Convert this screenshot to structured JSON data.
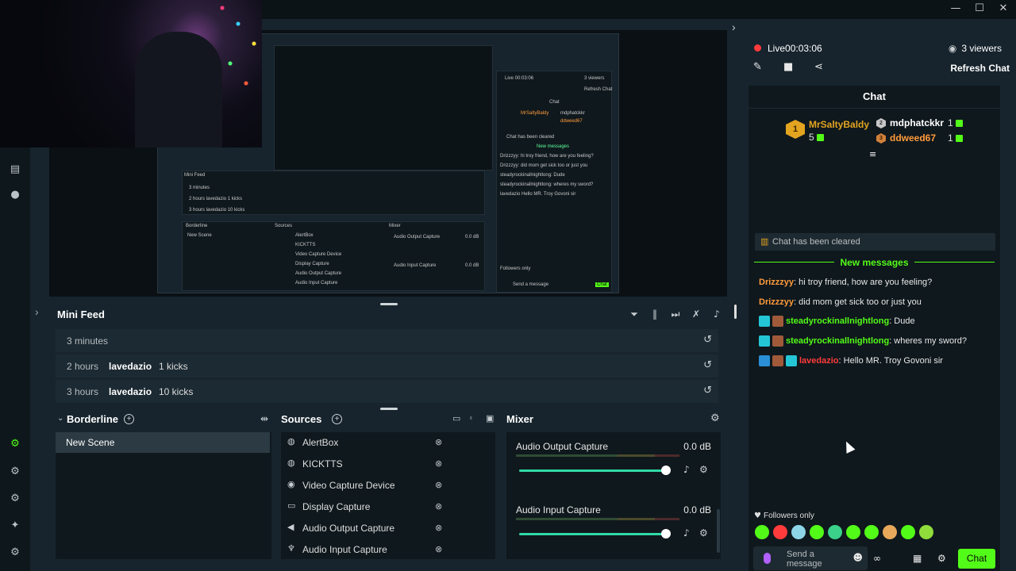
{
  "window": {
    "minimize": "—",
    "maximize": "☐",
    "close": "✕"
  },
  "mini_feed": {
    "title": "Mini Feed",
    "rows": [
      {
        "time": "3 minutes",
        "user": "",
        "detail": ""
      },
      {
        "time": "2 hours",
        "user": "lavedazio",
        "detail": "1 kicks"
      },
      {
        "time": "3 hours",
        "user": "lavedazio",
        "detail": "10 kicks"
      }
    ]
  },
  "scenes": {
    "title": "Borderline",
    "items": [
      "New Scene"
    ]
  },
  "sources": {
    "title": "Sources",
    "items": [
      {
        "name": "AlertBox",
        "icon": "globe-icon"
      },
      {
        "name": "KICKTTS",
        "icon": "globe-icon"
      },
      {
        "name": "Video Capture Device",
        "icon": "webcam-icon"
      },
      {
        "name": "Display Capture",
        "icon": "monitor-icon"
      },
      {
        "name": "Audio Output Capture",
        "icon": "speaker-icon"
      },
      {
        "name": "Audio Input Capture",
        "icon": "microphone-icon"
      }
    ]
  },
  "mixer": {
    "title": "Mixer",
    "items": [
      {
        "name": "Audio Output Capture",
        "level": "0.0 dB",
        "fader": 1.0
      },
      {
        "name": "Audio Input Capture",
        "level": "0.0 dB",
        "fader": 1.0
      }
    ]
  },
  "chat_panel": {
    "live_label": "Live",
    "live_time": "00:03:06",
    "viewers": "3 viewers",
    "refresh_label": "Refresh Chat",
    "chat_title": "Chat",
    "leaderboard": {
      "first": {
        "rank": "1",
        "name": "MrSaltyBaldy",
        "count": "5"
      },
      "second": {
        "name": "mdphatckkr",
        "count": "1"
      },
      "third": {
        "name": "ddweed67",
        "count": "1"
      }
    },
    "cleared_text": "Chat has been cleared",
    "new_messages_label": "New messages",
    "messages": [
      {
        "user": "Drizzzyy",
        "text": ": hi troy friend, how are you feeling?",
        "color": "#ff9b3b"
      },
      {
        "user": "Drizzzyy",
        "text": ": did mom get sick too or just you",
        "color": "#ff9b3b"
      },
      {
        "user": "steadyrockinallnightlong",
        "text": ": Dude",
        "color": "#53fc18"
      },
      {
        "user": "steadyrockinallnightlong",
        "text": ": wheres my sword?",
        "color": "#53fc18"
      },
      {
        "user": "lavedazio",
        "text": ": Hello MR. Troy Govoni sir",
        "color": "#ff3b3b"
      }
    ],
    "followers_only": "Followers only",
    "send_placeholder": "Send a message",
    "send_button": "Chat"
  },
  "preview_mini": {
    "live": "Live 00:03:06",
    "viewers": "3 viewers",
    "refresh": "Refresh Chat",
    "chat": "Chat",
    "top": "MrSaltyBaldy",
    "second": "mdphatckkr",
    "third": "ddweed67",
    "cleared": "Chat has been cleared",
    "new_messages": "New messages",
    "m1": "Drizzzyy: hi troy friend, how are you feeling?",
    "m2": "Drizzzyy: did mom get sick too or just you",
    "m3": "steadyrockinallnightlong: Dude",
    "m4": "steadyrockinallnightlong: wheres my sword?",
    "m5": "lavedazio Hello MR. Troy Govoni sir",
    "mini_feed": "Mini Feed",
    "r1": "3 minutes",
    "r2": "2 hours  lavedazio  1 kicks",
    "r3": "3 hours  lavedazio  10 kicks",
    "borderline": "Borderline",
    "sources": "Sources",
    "mixer": "Mixer",
    "new_scene": "New Scene",
    "s1": "AlertBox",
    "s2": "KICKTTS",
    "s3": "Video Capture Device",
    "s4": "Display Capture",
    "s5": "Audio Output Capture",
    "s6": "Audio Input Capture",
    "mx1": "Audio Output Capture",
    "mx2": "Audio Input Capture",
    "db": "0.0 dB",
    "followers": "Followers only",
    "send": "Send a message",
    "chat_btn": "Chat"
  },
  "colors": {
    "accent": "#53fc18",
    "live": "#ff3b3b",
    "gold": "#e3a41f",
    "background": "#17242d",
    "panel": "#0f181d"
  }
}
